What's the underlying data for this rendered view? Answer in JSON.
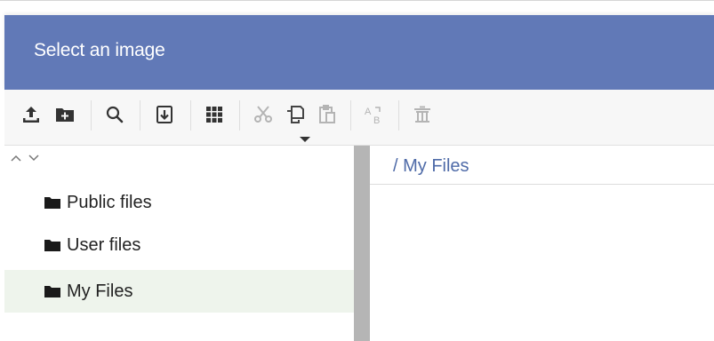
{
  "dialog": {
    "title": "Select an image"
  },
  "toolbar": {
    "buttons": [
      {
        "name": "upload",
        "icon": "upload-icon",
        "enabled": true
      },
      {
        "name": "new-folder",
        "icon": "new-folder-icon",
        "enabled": true
      },
      {
        "name": "search",
        "icon": "search-icon",
        "enabled": true
      },
      {
        "name": "download",
        "icon": "download-icon",
        "enabled": true
      },
      {
        "name": "view-mode",
        "icon": "grid-icon",
        "enabled": true
      },
      {
        "name": "cut",
        "icon": "scissors-icon",
        "enabled": false
      },
      {
        "name": "copy",
        "icon": "copy-icon",
        "enabled": false
      },
      {
        "name": "paste",
        "icon": "paste-icon",
        "enabled": false
      },
      {
        "name": "rename",
        "icon": "rename-icon",
        "enabled": false
      },
      {
        "name": "delete",
        "icon": "trash-icon",
        "enabled": false
      }
    ]
  },
  "tree": {
    "sort_up": "^",
    "sort_down": "v",
    "items": [
      {
        "label": "Public files",
        "selected": false
      },
      {
        "label": "User files",
        "selected": false
      },
      {
        "label": "My Files",
        "selected": true
      }
    ]
  },
  "main": {
    "breadcrumb": "/ My Files"
  },
  "colors": {
    "titlebar": "#6179b7",
    "selection": "#eef4ec",
    "link": "#4f6ba8"
  }
}
